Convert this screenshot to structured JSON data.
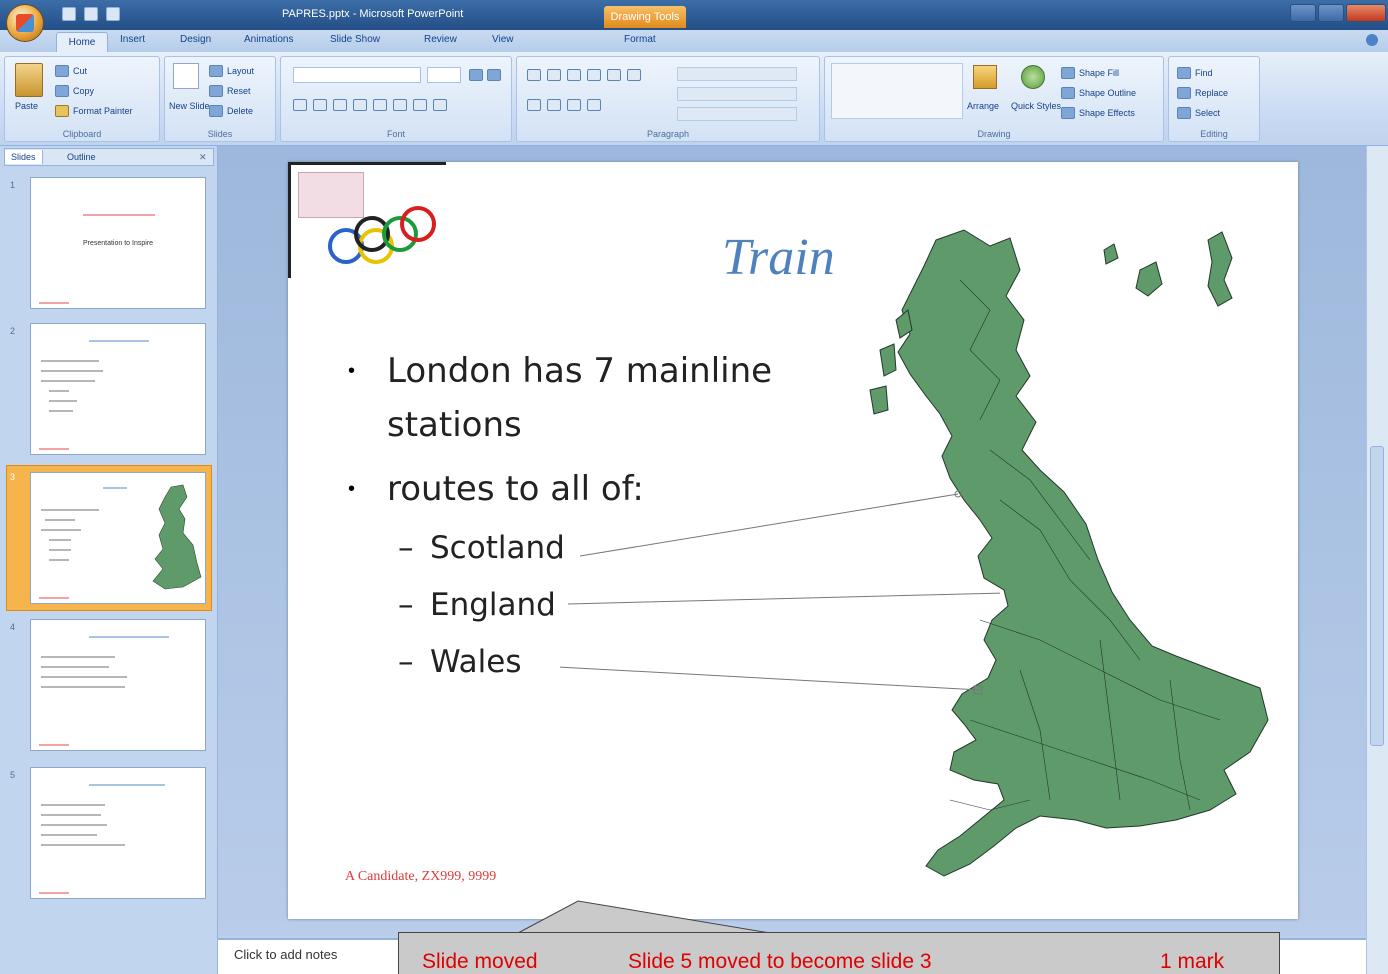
{
  "app": {
    "title": "PAPRES.pptx - Microsoft PowerPoint",
    "contextual_tab": "Drawing Tools"
  },
  "ribbon": {
    "tabs": [
      "Home",
      "Insert",
      "Design",
      "Animations",
      "Slide Show",
      "Review",
      "View",
      "Format"
    ],
    "groups": {
      "clipboard": {
        "label": "Clipboard",
        "paste": "Paste",
        "cut": "Cut",
        "copy": "Copy",
        "format_painter": "Format Painter"
      },
      "slides": {
        "label": "Slides",
        "new_slide": "New Slide",
        "layout": "Layout",
        "reset": "Reset",
        "delete": "Delete"
      },
      "font": {
        "label": "Font"
      },
      "paragraph": {
        "label": "Paragraph"
      },
      "drawing": {
        "label": "Drawing",
        "arrange": "Arrange",
        "quick_styles": "Quick Styles",
        "shape_fill": "Shape Fill",
        "shape_outline": "Shape Outline",
        "shape_effects": "Shape Effects"
      },
      "editing": {
        "label": "Editing",
        "find": "Find",
        "replace": "Replace",
        "select": "Select"
      }
    }
  },
  "pane": {
    "tabs": [
      "Slides",
      "Outline"
    ],
    "thumbnails": [
      {
        "num": "1",
        "text": "Presentation to Inspire"
      },
      {
        "num": "2",
        "text": ""
      },
      {
        "num": "3",
        "text": ""
      },
      {
        "num": "4",
        "text": ""
      },
      {
        "num": "5",
        "text": ""
      }
    ]
  },
  "slide": {
    "title": "Train",
    "bullets": [
      {
        "text": "London has 7 mainline"
      },
      {
        "text": "stations"
      },
      {
        "text": "routes to all of:"
      }
    ],
    "subbullets": [
      "Scotland",
      "England",
      "Wales"
    ],
    "footer": "A Candidate, ZX999, 9999",
    "map_color": "#5f9a6a"
  },
  "notes": {
    "placeholder": "Click to add notes"
  },
  "callout": {
    "label": "Slide moved",
    "description": "Slide 5 moved to become slide 3",
    "mark": "1 mark"
  }
}
